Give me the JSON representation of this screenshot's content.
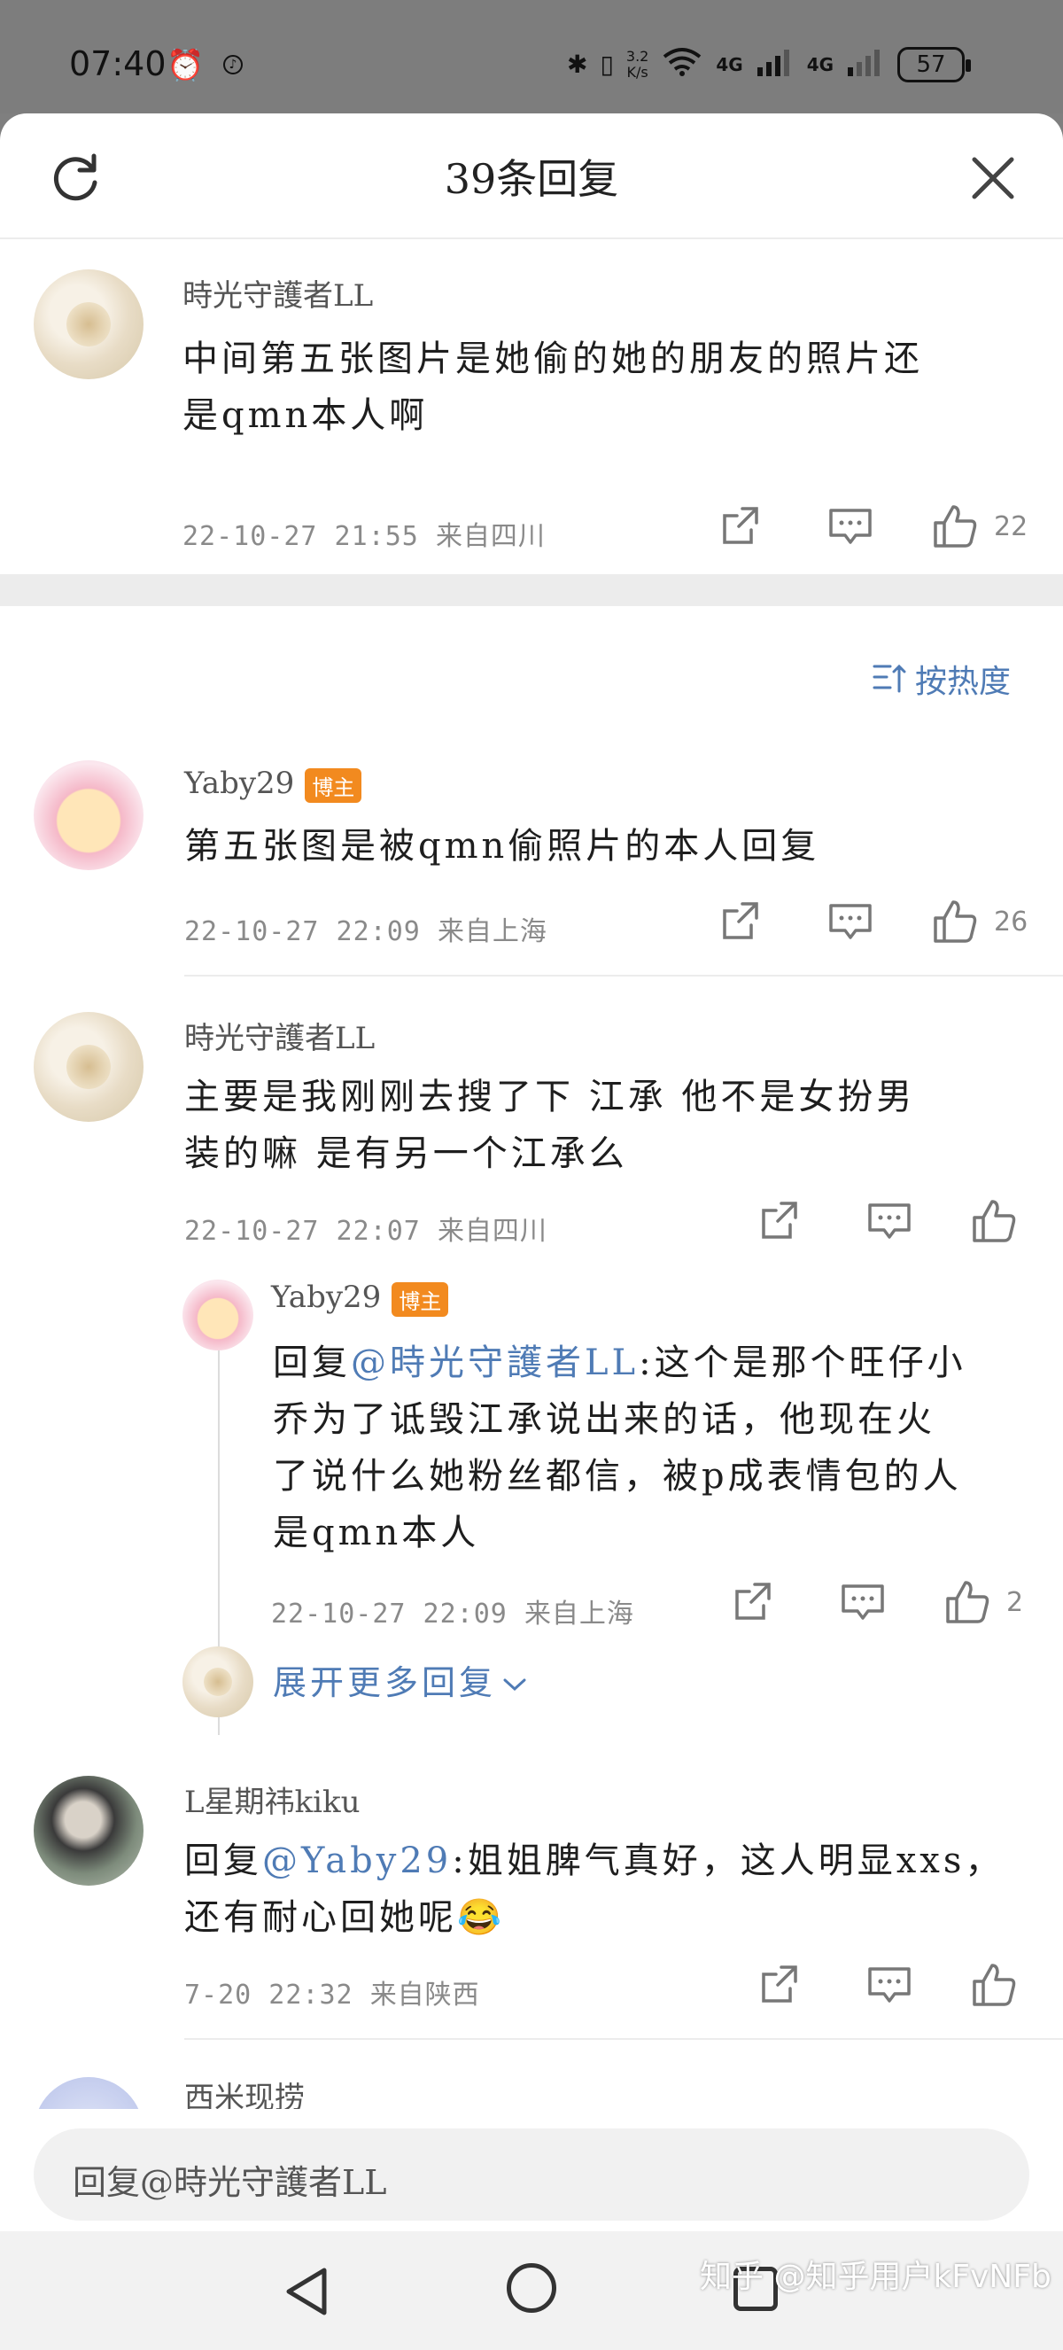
{
  "status_bar": {
    "time": "07:40",
    "net_speed_value": "3.2",
    "net_speed_unit": "K/s",
    "signal1": "4G",
    "signal2": "4G",
    "battery": "57"
  },
  "header": {
    "title": "39条回复"
  },
  "root_comment": {
    "username": "時光守護者LL",
    "text_line1": "中间第五张图片是她偷的她的朋友的照片还",
    "text_line2": "是qmn本人啊",
    "time": "22-10-27  21:55",
    "location": "来自四川",
    "likes": "22"
  },
  "sort_label": "按热度",
  "replies": [
    {
      "username": "Yaby29",
      "badge": "博主",
      "text_line1": "第五张图是被qmn偷照片的本人回复",
      "time": "22-10-27  22:09",
      "location": "来自上海",
      "likes": "26"
    },
    {
      "username": "時光守護者LL",
      "text_line1": "主要是我刚刚去搜了下  江承  他不是女扮男",
      "text_line2": "装的嘛  是有另一个江承么",
      "time": "22-10-27  22:07",
      "location": "来自四川",
      "likes": ""
    },
    {
      "username": "Yaby29",
      "badge": "博主",
      "reply_prefix": "回复",
      "mention": "@時光守護者LL",
      "text_line1_rest": ":这个是那个旺仔小",
      "text_line2": "乔为了诋毁江承说出来的话，他现在火",
      "text_line3": "了说什么她粉丝都信，被p成表情包的人",
      "text_line4": "是qmn本人",
      "time": "22-10-27  22:09",
      "location": "来自上海",
      "likes": "2"
    },
    {
      "username": "L星期祎kiku",
      "reply_prefix": "回复",
      "mention": "@Yaby29",
      "text_line1_rest": ":姐姐脾气真好，这人明显xxs，",
      "text_line2": "还有耐心回她呢😂",
      "time": "7-20  22:32",
      "location": "来自陕西",
      "likes": ""
    },
    {
      "username": "西米现捞"
    }
  ],
  "expand_more": "展开更多回复",
  "input": {
    "placeholder": "回复@時光守護者LL"
  },
  "watermark": "知乎 @知乎用户kFvNFb"
}
